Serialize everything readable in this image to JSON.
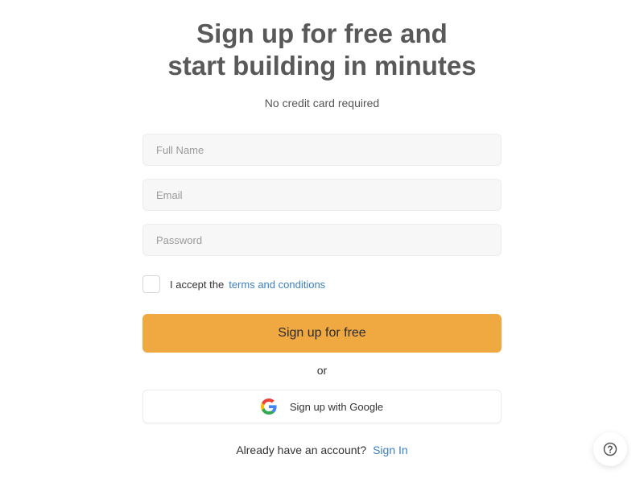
{
  "header": {
    "title_line1": "Sign up for free and",
    "title_line2": "start building in minutes",
    "subtitle": "No credit card required"
  },
  "form": {
    "full_name": {
      "value": "",
      "placeholder": "Full Name"
    },
    "email": {
      "value": "",
      "placeholder": "Email"
    },
    "password": {
      "value": "",
      "placeholder": "Password"
    },
    "terms": {
      "checked": false,
      "prefix": "I accept the",
      "link_label": "terms and conditions"
    },
    "submit_label": "Sign up for free",
    "divider_label": "or",
    "google_label": "Sign up with Google"
  },
  "footer": {
    "question": "Already have an account?",
    "signin_label": "Sign In"
  },
  "icons": {
    "google": "google-logo-icon",
    "help": "help-circle-icon"
  },
  "colors": {
    "primary": "#f0a941",
    "link": "#3d7fc1",
    "heading": "#595959"
  }
}
